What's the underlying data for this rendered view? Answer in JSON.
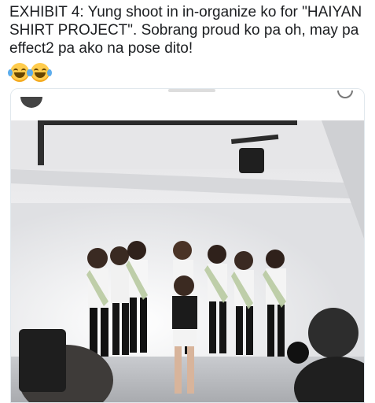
{
  "post": {
    "text": "EXHIBIT 4: Yung shoot in in-organize ko for \"HAIYAN SHIRT PROJECT\". Sobrang proud ko pa oh, may pa effect2 pa ako na pose dito!",
    "emojis": [
      "face-with-tears-of-joy",
      "face-with-tears-of-joy"
    ]
  },
  "embed": {
    "photo_subject": "group-photo"
  },
  "colors": {
    "text": "#1c1e21",
    "border": "#e1e8ed",
    "emoji_face": "#ffcc4d",
    "emoji_tear": "#5dadec"
  }
}
